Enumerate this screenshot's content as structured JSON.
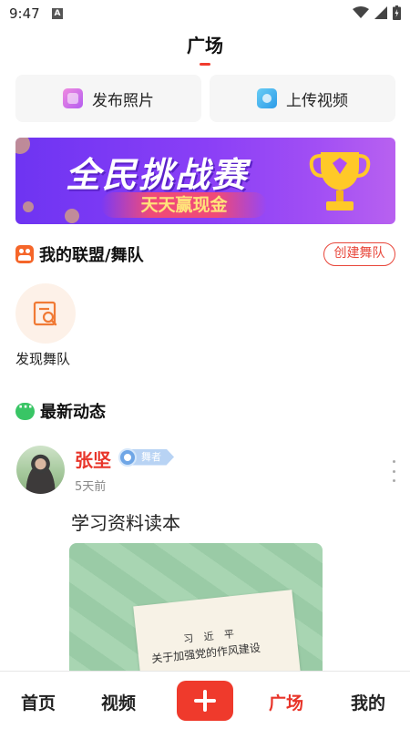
{
  "status_bar": {
    "time": "9:47",
    "notification_badge": "A",
    "icons": [
      "wifi-icon",
      "signal-icon",
      "battery-charging-icon"
    ]
  },
  "header": {
    "title": "广场"
  },
  "actions": {
    "publish_photo": "发布照片",
    "upload_video": "上传视频"
  },
  "banner": {
    "title": "全民挑战赛",
    "subtitle": "天天赢现金"
  },
  "alliance": {
    "heading": "我的联盟/舞队",
    "create_button": "创建舞队",
    "discover_label": "发现舞队"
  },
  "latest": {
    "heading": "最新动态"
  },
  "post": {
    "author": "张坚",
    "badge": "舞者",
    "time": "5天前",
    "text": "学习资料读本",
    "image_author": "习 近 平",
    "image_title": "关于加强党的作风建设"
  },
  "bottom_nav": {
    "home": "首页",
    "video": "视频",
    "square": "广场",
    "mine": "我的"
  },
  "colors": {
    "accent": "#e8352a",
    "banner_start": "#6e34f2",
    "banner_end": "#b861f0",
    "badge": "#b8d3f4"
  }
}
